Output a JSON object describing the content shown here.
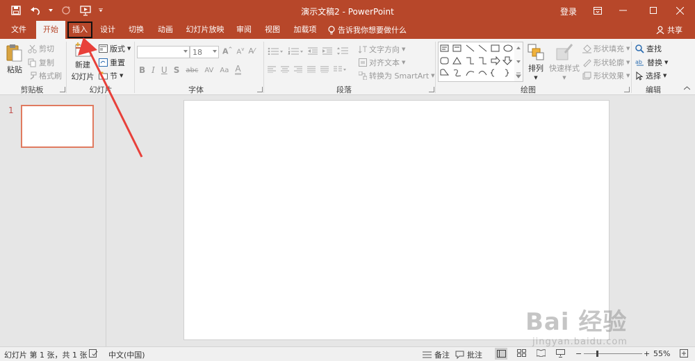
{
  "window": {
    "title": "演示文稿2 - PowerPoint",
    "login_label": "登录"
  },
  "tabs": [
    {
      "label": "文件"
    },
    {
      "label": "开始",
      "active": true
    },
    {
      "label": "插入",
      "highlighted": true
    },
    {
      "label": "设计"
    },
    {
      "label": "切换"
    },
    {
      "label": "动画"
    },
    {
      "label": "幻灯片放映"
    },
    {
      "label": "审阅"
    },
    {
      "label": "视图"
    },
    {
      "label": "加载项"
    }
  ],
  "tellme": "告诉我你想要做什么",
  "share": "共享",
  "ribbon": {
    "clipboard": {
      "label": "剪贴板",
      "paste": "粘贴",
      "cut": "剪切",
      "copy": "复制",
      "format_painter": "格式刷"
    },
    "slides": {
      "label": "幻灯片",
      "new_slide_line1": "新建",
      "new_slide_line2": "幻灯片",
      "layout": "版式",
      "reset": "重置",
      "section": "节"
    },
    "font": {
      "label": "字体",
      "font_size": "18"
    },
    "paragraph": {
      "label": "段落",
      "text_direction": "文字方向",
      "align_text": "对齐文本",
      "convert_smartart": "转换为 SmartArt"
    },
    "drawing": {
      "label": "绘图",
      "arrange": "排列",
      "quick_styles": "快速样式",
      "shape_fill": "形状填充",
      "shape_outline": "形状轮廓",
      "shape_effects": "形状效果"
    },
    "editing": {
      "label": "编辑",
      "find": "查找",
      "replace": "替换",
      "select": "选择"
    }
  },
  "slide_panel": {
    "slide_number": "1"
  },
  "status": {
    "slide_info": "幻灯片 第 1 张，共 1 张",
    "language": "中文(中国)",
    "notes": "备注",
    "comments": "批注",
    "zoom": "55%"
  },
  "watermark": {
    "main": "Bai 经验",
    "sub": "jingyan.baidu.com"
  },
  "colors": {
    "accent": "#b7472a",
    "annotation": "#e8403a"
  }
}
